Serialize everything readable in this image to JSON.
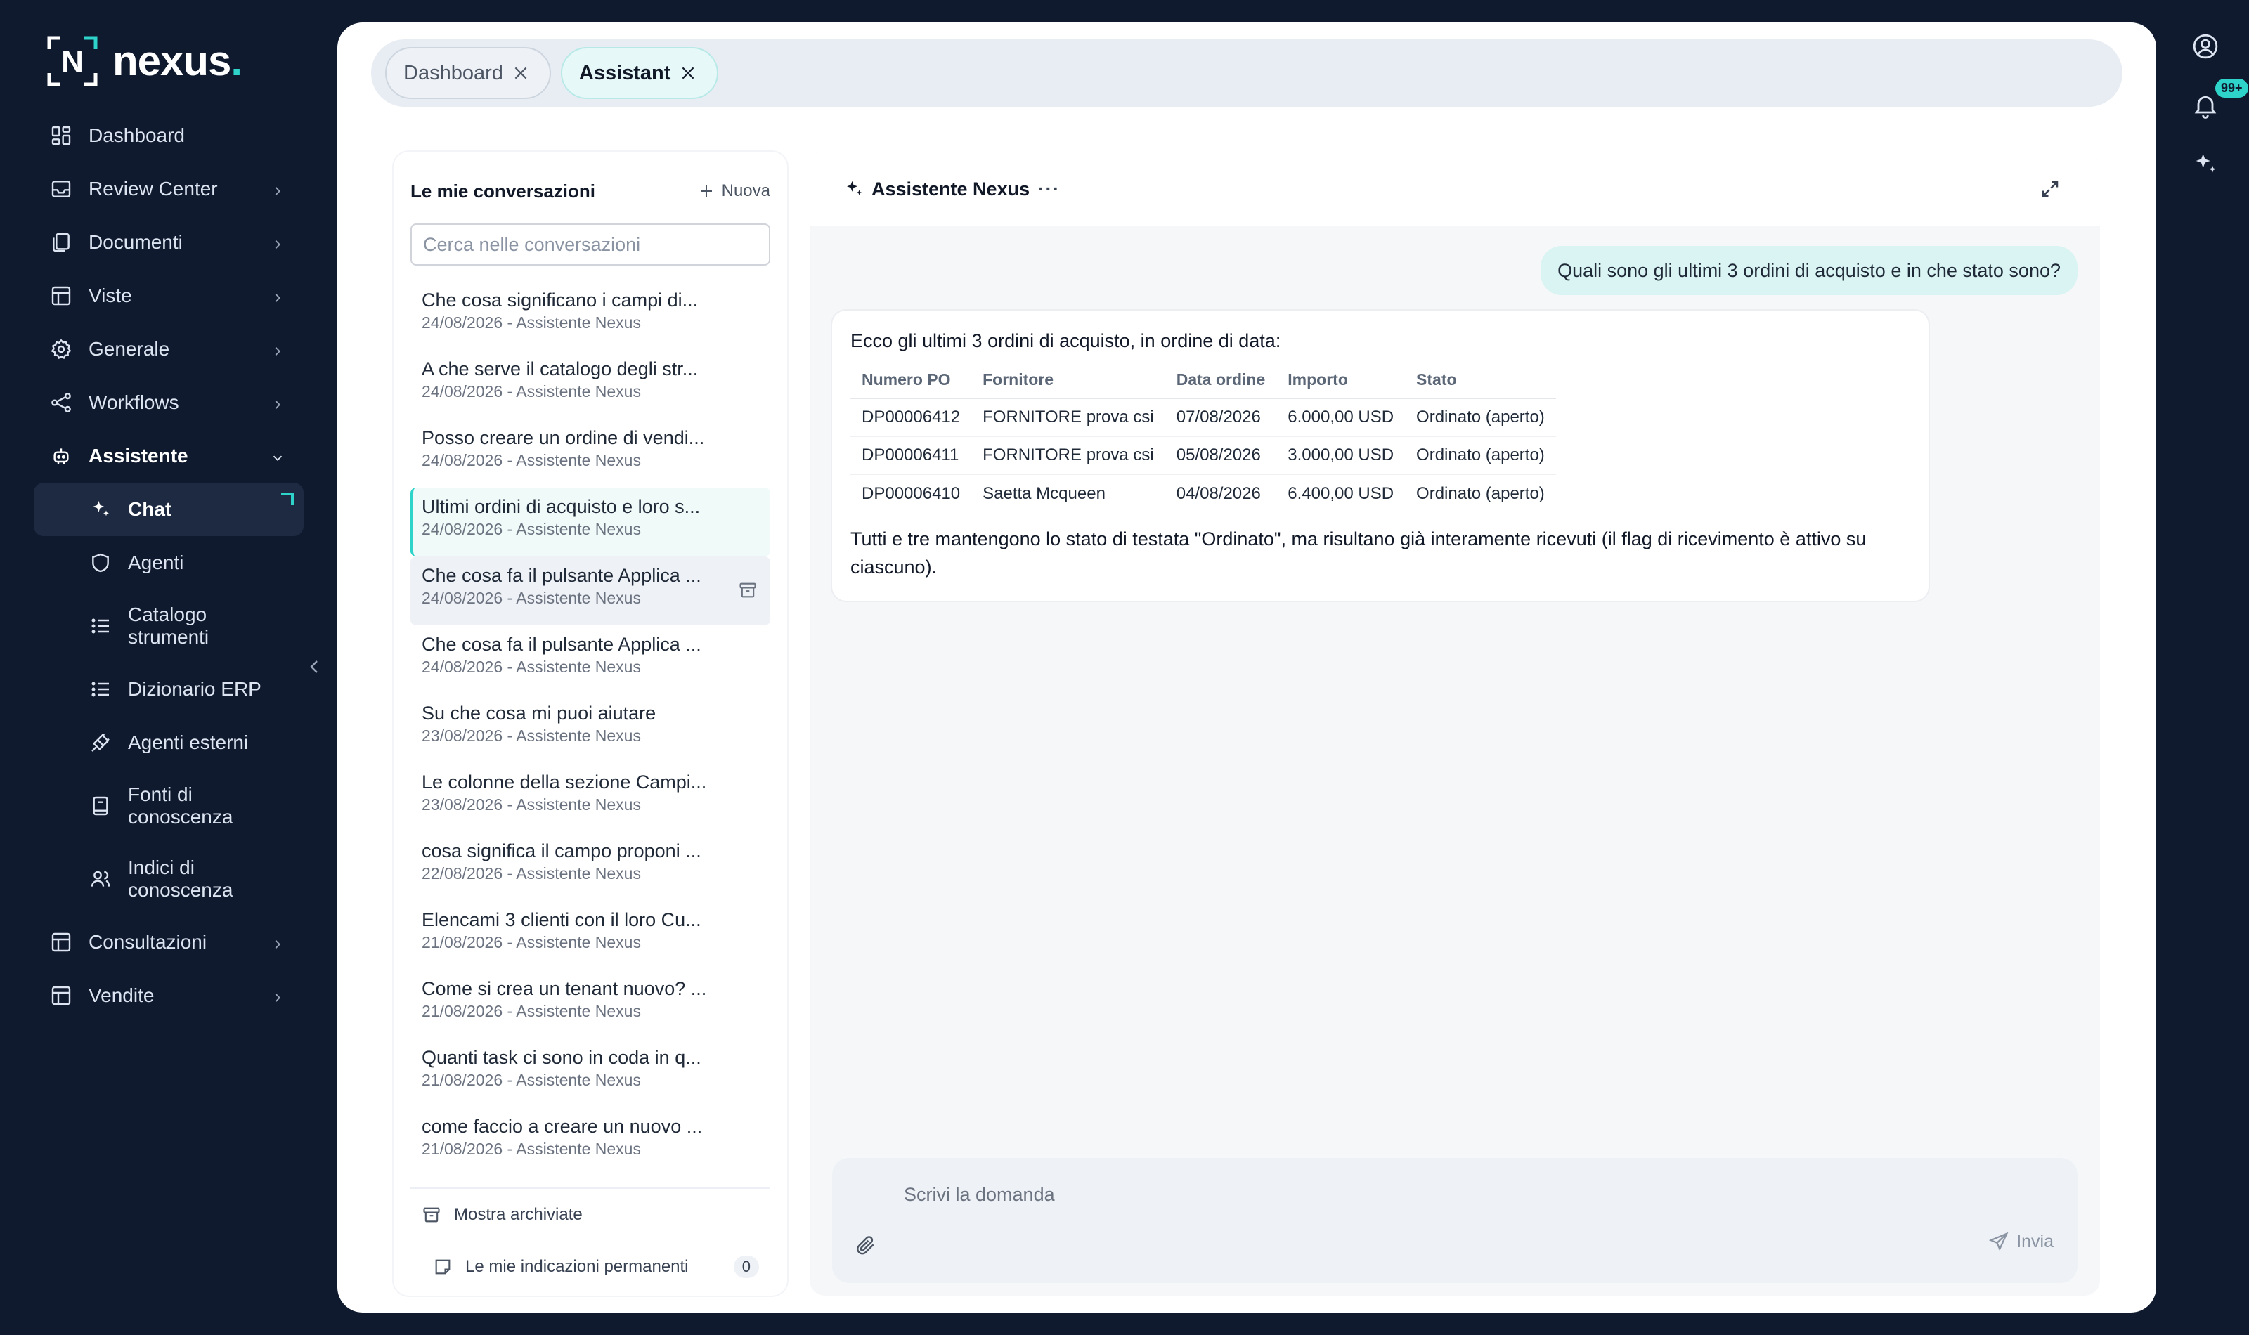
{
  "brand": {
    "name": "nexus",
    "dot": "."
  },
  "sidebar": {
    "items": [
      {
        "label": "Dashboard"
      },
      {
        "label": "Review Center"
      },
      {
        "label": "Documenti"
      },
      {
        "label": "Viste"
      },
      {
        "label": "Generale"
      },
      {
        "label": "Workflows"
      },
      {
        "label": "Assistente"
      }
    ],
    "assistente_sub": [
      {
        "label": "Chat"
      },
      {
        "label": "Agenti"
      },
      {
        "label": "Catalogo strumenti"
      },
      {
        "label": "Dizionario ERP"
      },
      {
        "label": "Agenti esterni"
      },
      {
        "label": "Fonti di conoscenza"
      },
      {
        "label": "Indici di conoscenza"
      }
    ],
    "after": [
      {
        "label": "Consultazioni"
      },
      {
        "label": "Vendite"
      }
    ]
  },
  "rail": {
    "notifications_badge": "99+"
  },
  "tabs": [
    {
      "label": "Dashboard"
    },
    {
      "label": "Assistant"
    }
  ],
  "conversations": {
    "title": "Le mie conversazioni",
    "new_label": "Nuova",
    "search_placeholder": "Cerca nelle conversazioni",
    "items": [
      {
        "title": "Che cosa significano i campi di...",
        "meta": "24/08/2026 - Assistente Nexus"
      },
      {
        "title": "A che serve il catalogo degli str...",
        "meta": "24/08/2026 - Assistente Nexus"
      },
      {
        "title": "Posso creare un ordine di vendi...",
        "meta": "24/08/2026 - Assistente Nexus"
      },
      {
        "title": "Ultimi ordini di acquisto e loro s...",
        "meta": "24/08/2026 - Assistente Nexus"
      },
      {
        "title": "Che cosa fa il pulsante Applica ...",
        "meta": "24/08/2026 - Assistente Nexus"
      },
      {
        "title": "Che cosa fa il pulsante Applica ...",
        "meta": "24/08/2026 - Assistente Nexus"
      },
      {
        "title": "Su che cosa mi puoi aiutare",
        "meta": "23/08/2026 - Assistente Nexus"
      },
      {
        "title": "Le colonne della sezione Campi...",
        "meta": "23/08/2026 - Assistente Nexus"
      },
      {
        "title": "cosa significa il campo proponi ...",
        "meta": "22/08/2026 - Assistente Nexus"
      },
      {
        "title": "Elencami 3 clienti con il loro Cu...",
        "meta": "21/08/2026 - Assistente Nexus"
      },
      {
        "title": "Come si crea un tenant nuovo? ...",
        "meta": "21/08/2026 - Assistente Nexus"
      },
      {
        "title": "Quanti task ci sono in coda in q...",
        "meta": "21/08/2026 - Assistente Nexus"
      },
      {
        "title": "come faccio a creare un nuovo ...",
        "meta": "21/08/2026 - Assistente Nexus"
      }
    ],
    "show_archived": "Mostra archiviate",
    "permanent": "Le mie indicazioni permanenti",
    "permanent_count": "0"
  },
  "chat": {
    "title": "Assistente Nexus",
    "menu": "···",
    "user_message": "Quali sono gli ultimi 3 ordini di acquisto e in che stato sono?",
    "bot_intro": "Ecco gli ultimi 3 ordini di acquisto, in ordine di data:",
    "table": {
      "headers": [
        "Numero PO",
        "Fornitore",
        "Data ordine",
        "Importo",
        "Stato"
      ],
      "rows": [
        [
          "DP00006412",
          "FORNITORE prova csi",
          "07/08/2026",
          "6.000,00 USD",
          "Ordinato (aperto)"
        ],
        [
          "DP00006411",
          "FORNITORE prova csi",
          "05/08/2026",
          "3.000,00 USD",
          "Ordinato (aperto)"
        ],
        [
          "DP00006410",
          "Saetta Mcqueen",
          "04/08/2026",
          "6.400,00 USD",
          "Ordinato (aperto)"
        ]
      ]
    },
    "bot_outro": "Tutti e tre mantengono lo stato di testata \"Ordinato\", ma risultano già interamente ricevuti (il flag di ricevimento è attivo su ciascuno).",
    "input_placeholder": "Scrivi la domanda",
    "send_label": "Invia"
  },
  "colors": {
    "accent": "#2ed3c9",
    "sidebar_bg": "#0f1a2e",
    "user_bubble": "#d9f4f3"
  }
}
